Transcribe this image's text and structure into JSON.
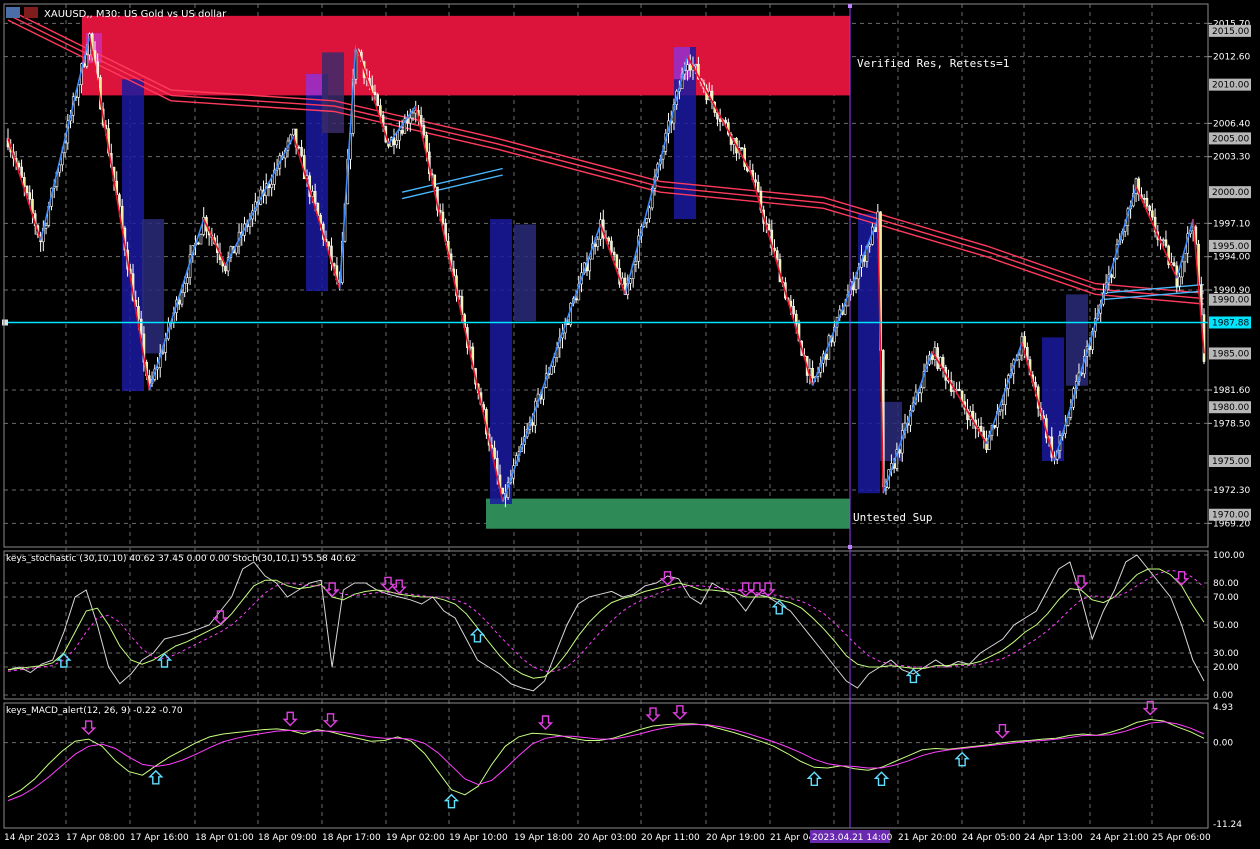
{
  "header": {
    "symbol_line": "XAUUSD,, M30:  US Gold vs US dollar"
  },
  "zones": {
    "resistance_label": "Verified Res, Retests=1",
    "support_label": "Untested Sup"
  },
  "chart_data": [
    {
      "type": "candlestick",
      "title": "XAUUSD,, M30:  US Gold vs US dollar",
      "ylim": [
        1967.0,
        2017.5
      ],
      "price_axis_ticks": [
        2015.7,
        2012.6,
        2006.4,
        2003.3,
        1997.1,
        1994.0,
        1990.9,
        1981.6,
        1978.5,
        1972.3,
        1969.2
      ],
      "price_axis_boxed_labels": [
        {
          "text": "2015.00",
          "value": 2015.0
        },
        {
          "text": "2010.00",
          "value": 2010.0
        },
        {
          "text": "2005.00",
          "value": 2005.0
        },
        {
          "text": "2000.00",
          "value": 2000.0
        },
        {
          "text": "1995.00",
          "value": 1995.0
        },
        {
          "text": "1990.00",
          "value": 1990.0
        },
        {
          "text": "1985.00",
          "value": 1985.0
        },
        {
          "text": "1980.00",
          "value": 1980.0
        },
        {
          "text": "1975.00",
          "value": 1975.0
        },
        {
          "text": "1970.00",
          "value": 1970.0
        }
      ],
      "current_price": {
        "text": "1987.88",
        "value": 1987.88,
        "color": "#00e5ff"
      },
      "zigzag_points": [
        {
          "i": 0,
          "price": 2005.0
        },
        {
          "i": 12,
          "price": 1995.5
        },
        {
          "i": 30,
          "price": 2014.5
        },
        {
          "i": 52,
          "price": 1981.6
        },
        {
          "i": 72,
          "price": 1997.5
        },
        {
          "i": 80,
          "price": 1993.2
        },
        {
          "i": 105,
          "price": 2005.2
        },
        {
          "i": 122,
          "price": 1991.0
        },
        {
          "i": 128,
          "price": 2013.7
        },
        {
          "i": 140,
          "price": 2004.5
        },
        {
          "i": 150,
          "price": 2008.0
        },
        {
          "i": 182,
          "price": 1971.2
        },
        {
          "i": 218,
          "price": 1997.0
        },
        {
          "i": 227,
          "price": 1990.5
        },
        {
          "i": 250,
          "price": 2012.6
        },
        {
          "i": 273,
          "price": 2002.0
        },
        {
          "i": 296,
          "price": 1982.0
        },
        {
          "i": 320,
          "price": 1997.5
        },
        {
          "i": 322,
          "price": 1972.0
        },
        {
          "i": 340,
          "price": 1985.2
        },
        {
          "i": 360,
          "price": 1976.6
        },
        {
          "i": 373,
          "price": 1986.0
        },
        {
          "i": 385,
          "price": 1975.0
        },
        {
          "i": 415,
          "price": 2000.5
        },
        {
          "i": 430,
          "price": 1992.0
        },
        {
          "i": 436,
          "price": 1997.5
        },
        {
          "i": 440,
          "price": 1985.0
        }
      ],
      "moving_averages": [
        {
          "name": "",
          "color": "#ff3b5c",
          "points": [
            [
              0,
              2017.0
            ],
            [
              60,
              2009.5
            ],
            [
              120,
              2008.5
            ],
            [
              180,
              2005.0
            ],
            [
              240,
              2001.0
            ],
            [
              300,
              1999.5
            ],
            [
              360,
              1995.0
            ],
            [
              400,
              1991.5
            ],
            [
              440,
              1990.6
            ]
          ]
        },
        {
          "name": "",
          "color": "#ff3b5c",
          "points": [
            [
              0,
              2016.5
            ],
            [
              60,
              2009.0
            ],
            [
              120,
              2008.0
            ],
            [
              180,
              2004.5
            ],
            [
              240,
              2000.5
            ],
            [
              300,
              1999.0
            ],
            [
              360,
              1994.5
            ],
            [
              400,
              1991.0
            ],
            [
              440,
              1990.1
            ]
          ]
        },
        {
          "name": "",
          "color": "#ff3b5c",
          "points": [
            [
              0,
              2016.0
            ],
            [
              60,
              2008.5
            ],
            [
              120,
              2007.5
            ],
            [
              180,
              2004.0
            ],
            [
              240,
              2000.0
            ],
            [
              300,
              1998.5
            ],
            [
              360,
              1994.0
            ],
            [
              400,
              1990.5
            ],
            [
              440,
              1989.6
            ]
          ]
        }
      ],
      "x_axis_labels": [
        "14 Apr 2023",
        "17 Apr 08:00",
        "17 Apr 16:00",
        "18 Apr 01:00",
        "18 Apr 09:00",
        "18 Apr 17:00",
        "19 Apr 02:00",
        "19 Apr 10:00",
        "19 Apr 18:00",
        "20 Apr 03:00",
        "20 Apr 11:00",
        "20 Apr 19:00",
        "21 Apr 04:00",
        "2023.04.21 14:00",
        "21 Apr 20:00",
        "24 Apr 05:00",
        "24 Apr 13:00",
        "24 Apr 21:00",
        "25 Apr 06:00"
      ],
      "cursor_time_label": "2023.04.21 14:00",
      "grid": true
    },
    {
      "type": "line",
      "title": "keys_stochastic (30,10,10) 40.62 37.45 0.00 0.00 Stoch(30,10,1) 55.58 40.62",
      "ylim": [
        0,
        100
      ],
      "y_ticks": [
        "100.00",
        "80.00",
        "70.00",
        "50.00",
        "30.00",
        "20.00",
        "0.00"
      ],
      "levels": [
        100,
        80,
        70,
        50,
        30,
        20,
        0
      ],
      "series": [
        {
          "color": "#d8d8d8",
          "values": [
            18,
            20,
            16,
            22,
            25,
            45,
            70,
            75,
            50,
            20,
            8,
            15,
            25,
            30,
            40,
            42,
            44,
            47,
            50,
            60,
            70,
            90,
            95,
            85,
            80,
            70,
            75,
            80,
            82,
            20,
            75,
            80,
            80,
            75,
            72,
            70,
            68,
            65,
            70,
            60,
            55,
            40,
            25,
            20,
            15,
            8,
            5,
            3,
            10,
            30,
            50,
            65,
            70,
            72,
            74,
            70,
            72,
            78,
            80,
            85,
            83,
            70,
            65,
            80,
            75,
            70,
            60,
            72,
            70,
            65,
            60,
            50,
            40,
            30,
            20,
            10,
            5,
            15,
            20,
            25,
            18,
            15,
            20,
            25,
            20,
            24,
            22,
            30,
            35,
            40,
            50,
            55,
            60,
            75,
            90,
            95,
            70,
            40,
            60,
            75,
            95,
            100,
            90,
            80,
            70,
            50,
            25,
            10
          ]
        },
        {
          "color": "#c8ff80",
          "values": [
            18,
            19,
            20,
            21,
            23,
            30,
            45,
            60,
            62,
            50,
            35,
            25,
            22,
            25,
            30,
            35,
            38,
            42,
            46,
            50,
            58,
            68,
            78,
            82,
            82,
            78,
            76,
            77,
            79,
            70,
            68,
            72,
            74,
            75,
            74,
            72,
            71,
            70,
            70,
            68,
            65,
            58,
            48,
            38,
            28,
            20,
            15,
            12,
            13,
            20,
            30,
            42,
            52,
            60,
            66,
            69,
            71,
            74,
            76,
            78,
            80,
            78,
            75,
            75,
            74,
            73,
            70,
            70,
            70,
            68,
            66,
            62,
            55,
            47,
            38,
            28,
            22,
            20,
            20,
            21,
            20,
            19,
            19,
            21,
            21,
            22,
            22,
            24,
            28,
            32,
            38,
            45,
            50,
            58,
            68,
            76,
            75,
            68,
            66,
            70,
            78,
            86,
            90,
            90,
            86,
            78,
            64,
            52
          ]
        },
        {
          "color": "#ff40ff",
          "dashed": true,
          "values": [
            17,
            18,
            19,
            20,
            21,
            25,
            33,
            45,
            55,
            57,
            52,
            42,
            33,
            27,
            26,
            29,
            33,
            37,
            41,
            45,
            50,
            57,
            65,
            73,
            78,
            80,
            79,
            78,
            78,
            75,
            72,
            71,
            72,
            73,
            73,
            73,
            72,
            71,
            70,
            70,
            68,
            65,
            59,
            51,
            42,
            34,
            26,
            20,
            17,
            17,
            20,
            27,
            36,
            45,
            53,
            60,
            65,
            69,
            72,
            75,
            77,
            78,
            78,
            77,
            76,
            75,
            74,
            73,
            72,
            71,
            69,
            67,
            63,
            58,
            51,
            43,
            35,
            28,
            24,
            22,
            21,
            20,
            20,
            20,
            20,
            21,
            21,
            22,
            24,
            26,
            30,
            35,
            40,
            46,
            53,
            61,
            68,
            71,
            70,
            70,
            73,
            78,
            83,
            87,
            89,
            88,
            84,
            77
          ]
        }
      ],
      "markers": {
        "up": [
          10,
          28,
          82,
          135,
          158
        ],
        "down": [
          37,
          56,
          66,
          68,
          114,
          128,
          130,
          132,
          186,
          205
        ]
      }
    },
    {
      "type": "line",
      "title": "keys_MACD_alert(12, 26, 9) -0.22 -0.70",
      "ylim": [
        -11.24,
        4.93
      ],
      "y_ticks": [
        "4.93",
        "0.00",
        "-11.24"
      ],
      "series": [
        {
          "color": "#c8ff80",
          "values": [
            -7.5,
            -6.5,
            -5.0,
            -3.0,
            -1.2,
            0.2,
            0.5,
            -0.5,
            -2.5,
            -4.0,
            -4.5,
            -3.2,
            -2.0,
            -1.0,
            0.0,
            0.8,
            1.2,
            1.4,
            1.6,
            1.8,
            1.9,
            1.7,
            1.2,
            1.8,
            1.5,
            1.0,
            0.6,
            0.2,
            0.3,
            0.8,
            0.2,
            -1.5,
            -4.0,
            -6.5,
            -7.2,
            -6.0,
            -3.0,
            -0.5,
            0.8,
            1.3,
            1.2,
            1.0,
            0.6,
            0.3,
            0.3,
            0.6,
            1.2,
            1.8,
            2.3,
            2.5,
            2.6,
            2.6,
            2.4,
            1.9,
            1.4,
            0.8,
            0.2,
            -0.5,
            -1.5,
            -2.6,
            -3.4,
            -3.5,
            -3.2,
            -3.6,
            -3.8,
            -3.4,
            -2.6,
            -1.8,
            -1.0,
            -0.8,
            -0.9,
            -0.7,
            -0.5,
            -0.3,
            0.0,
            0.2,
            0.3,
            0.5,
            0.6,
            1.0,
            1.2,
            1.0,
            1.4,
            2.0,
            2.8,
            3.2,
            3.0,
            2.2,
            1.5,
            0.6
          ]
        },
        {
          "color": "#ff40ff",
          "values": [
            -8.0,
            -7.3,
            -6.2,
            -4.8,
            -3.2,
            -1.6,
            -0.5,
            -0.2,
            -0.8,
            -2.0,
            -3.0,
            -3.3,
            -3.0,
            -2.4,
            -1.6,
            -0.7,
            0.1,
            0.6,
            1.0,
            1.3,
            1.6,
            1.7,
            1.6,
            1.6,
            1.6,
            1.4,
            1.1,
            0.8,
            0.6,
            0.6,
            0.5,
            -0.1,
            -1.4,
            -3.2,
            -5.0,
            -5.8,
            -5.2,
            -3.6,
            -1.8,
            -0.2,
            0.6,
            0.9,
            0.9,
            0.7,
            0.5,
            0.5,
            0.8,
            1.2,
            1.7,
            2.1,
            2.4,
            2.5,
            2.5,
            2.2,
            1.8,
            1.3,
            0.7,
            0.1,
            -0.6,
            -1.4,
            -2.3,
            -2.9,
            -3.2,
            -3.3,
            -3.5,
            -3.5,
            -3.1,
            -2.5,
            -1.8,
            -1.3,
            -1.0,
            -0.8,
            -0.6,
            -0.4,
            -0.2,
            0.0,
            0.2,
            0.3,
            0.5,
            0.7,
            1.0,
            1.0,
            1.1,
            1.5,
            2.1,
            2.7,
            2.9,
            2.6,
            2.0,
            1.2
          ]
        }
      ],
      "markers": {
        "up": [
          11,
          33,
          60,
          65,
          71
        ],
        "down": [
          6,
          21,
          24,
          40,
          48,
          50,
          74,
          85
        ]
      }
    }
  ]
}
